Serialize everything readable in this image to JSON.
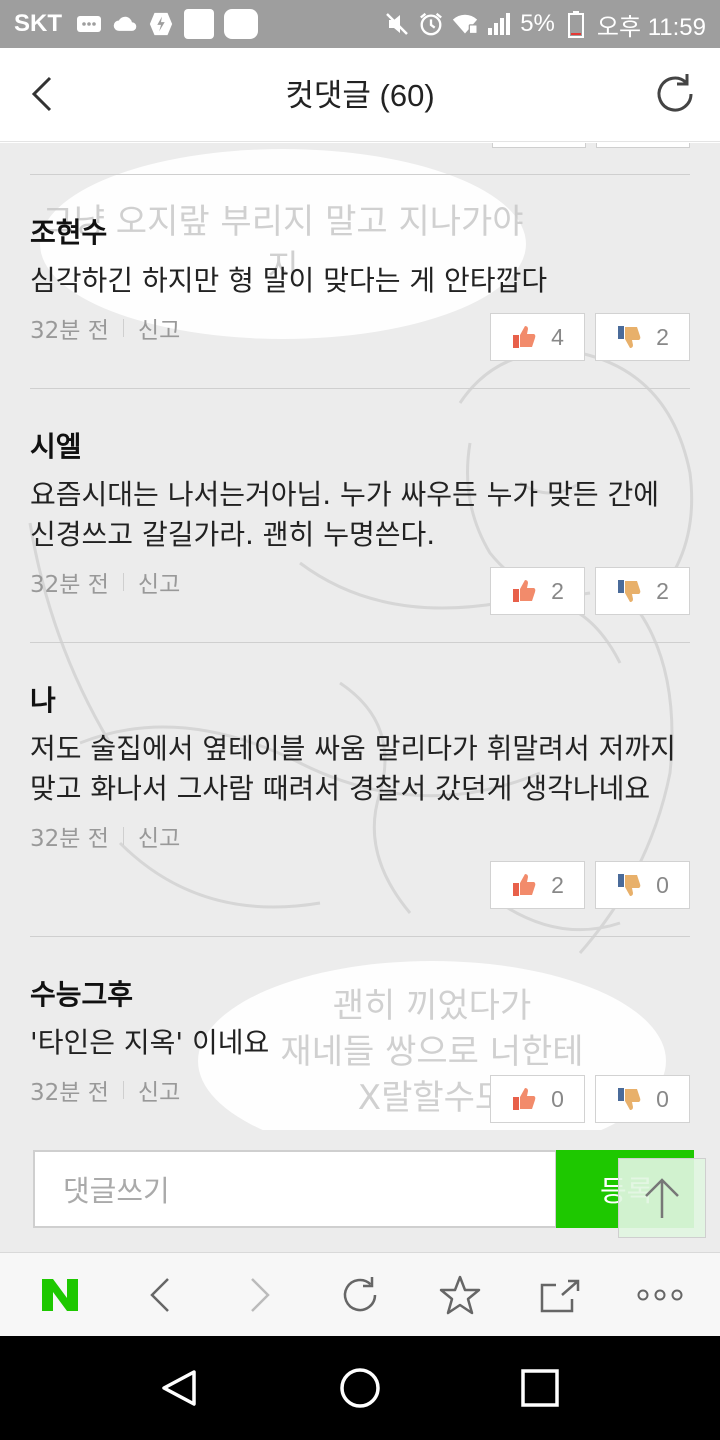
{
  "status_bar": {
    "carrier": "SKT",
    "battery": "5%",
    "time": "오후 11:59"
  },
  "header": {
    "title": "컷댓글 (60)"
  },
  "comments": [
    {
      "author": "조현수",
      "text": "심각하긴 하지만 형 말이 맞다는 게 안타깝다",
      "time": "32분 전",
      "report": "신고",
      "likes": "4",
      "dislikes": "2"
    },
    {
      "author": "시엘",
      "text": "요즘시대는 나서는거아님. 누가 싸우든 누가 맞든 간에 신경쓰고 갈길가라. 괜히 누명쓴다.",
      "time": "32분 전",
      "report": "신고",
      "likes": "2",
      "dislikes": "2"
    },
    {
      "author": "나",
      "text": "저도 술집에서 옆테이블 싸움 말리다가 휘말려서 저까지맞고 화나서 그사람 때려서 경찰서 갔던게 생각나네요",
      "time": "32분 전",
      "report": "신고",
      "likes": "2",
      "dislikes": "0"
    },
    {
      "author": "수능그후",
      "text": "'타인은 지옥' 이네요",
      "time": "32분 전",
      "report": "신고",
      "likes": "0",
      "dislikes": "0"
    }
  ],
  "bubbles": {
    "top": "그냥 오지랖 부리지 말고 지나가야지",
    "bottom_lines": [
      "괜히 끼었다가",
      "재네들 쌍으로 너한테",
      "X랄할수도"
    ]
  },
  "write_bar": {
    "placeholder": "댓글쓰기",
    "submit_label": "등록"
  },
  "colors": {
    "brand_green": "#1ec800",
    "status_bar": "#9e9e9e"
  },
  "icons": {
    "browser": [
      "naver-logo-icon",
      "back-icon",
      "forward-icon",
      "refresh-icon",
      "bookmark-star-icon",
      "share-icon",
      "more-icon"
    ],
    "nav": [
      "nav-back-icon",
      "nav-home-icon",
      "nav-recents-icon"
    ]
  }
}
